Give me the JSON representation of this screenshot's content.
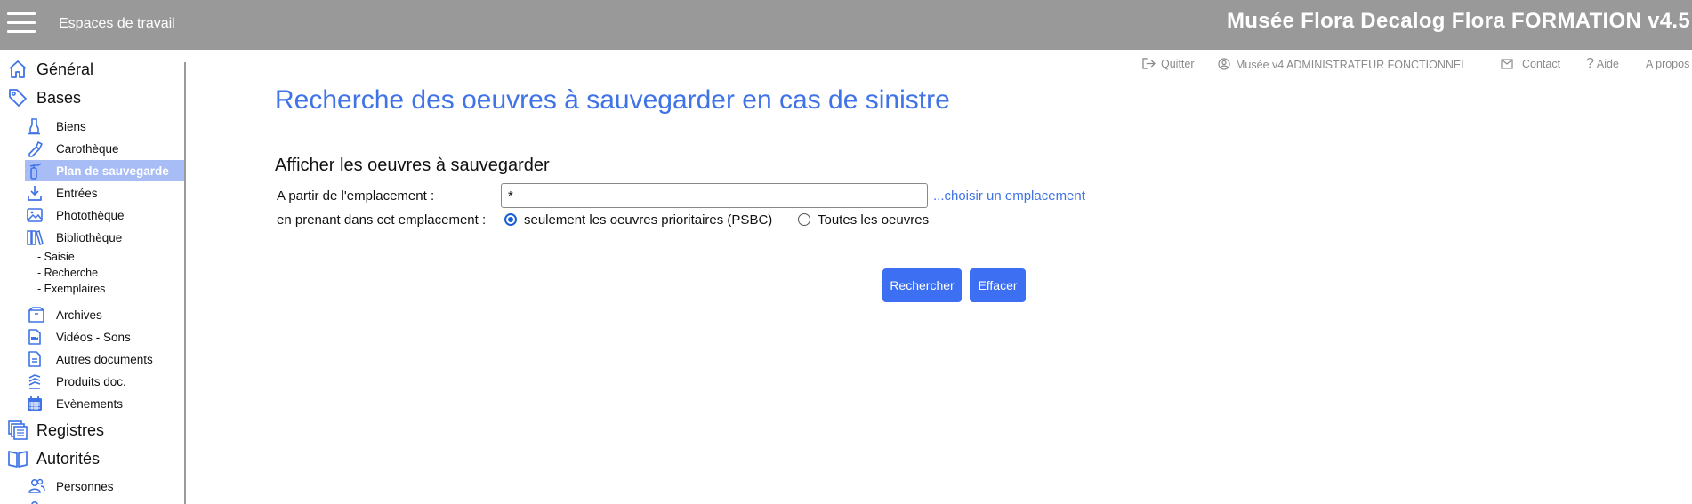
{
  "topbar": {
    "workspaces_label": "Espaces de travail",
    "app_title": "Musée Flora Decalog Flora FORMATION v4.5"
  },
  "sidebar": {
    "general": "Général",
    "bases": "Bases",
    "bases_items": [
      {
        "label": "Biens",
        "icon": "object-icon"
      },
      {
        "label": "Carothèque",
        "icon": "pen-icon"
      },
      {
        "label": "Plan de sauvegarde",
        "icon": "fire-extinguisher-icon"
      },
      {
        "label": "Entrées",
        "icon": "download-icon"
      },
      {
        "label": "Photothèque",
        "icon": "image-icon"
      },
      {
        "label": "Bibliothèque",
        "icon": "books-icon"
      }
    ],
    "library_sub": [
      "- Saisie",
      "- Recherche",
      "- Exemplaires"
    ],
    "bases_items2": [
      {
        "label": "Archives",
        "icon": "archive-box-icon"
      },
      {
        "label": "Vidéos - Sons",
        "icon": "video-file-icon"
      },
      {
        "label": "Autres documents",
        "icon": "document-icon"
      },
      {
        "label": "Produits doc.",
        "icon": "stack-icon"
      },
      {
        "label": "Evènements",
        "icon": "calendar-icon"
      }
    ],
    "registres": "Registres",
    "autorites": "Autorités",
    "personnes": "Personnes"
  },
  "toplinks": {
    "quit": "Quitter",
    "user": "Musée v4 ADMINISTRATEUR FONCTIONNEL",
    "contact": "Contact",
    "help": "Aide",
    "about": "A propos"
  },
  "main": {
    "title": "Recherche des oeuvres à sauvegarder en cas de sinistre",
    "section": "Afficher les oeuvres à sauvegarder",
    "location_label": "A partir de l'emplacement :",
    "location_value": "*",
    "choose_location": "...choisir un emplacement",
    "scope_label": "en prenant dans cet emplacement :",
    "radio_priority": "seulement les oeuvres prioritaires (PSBC)",
    "radio_all": "Toutes les oeuvres",
    "search_button": "Rechercher",
    "clear_button": "Effacer"
  },
  "colors": {
    "topbar": "#999999",
    "accent": "#3f73e6",
    "button": "#3d6ff2",
    "active_item": "#a8bdf6"
  }
}
